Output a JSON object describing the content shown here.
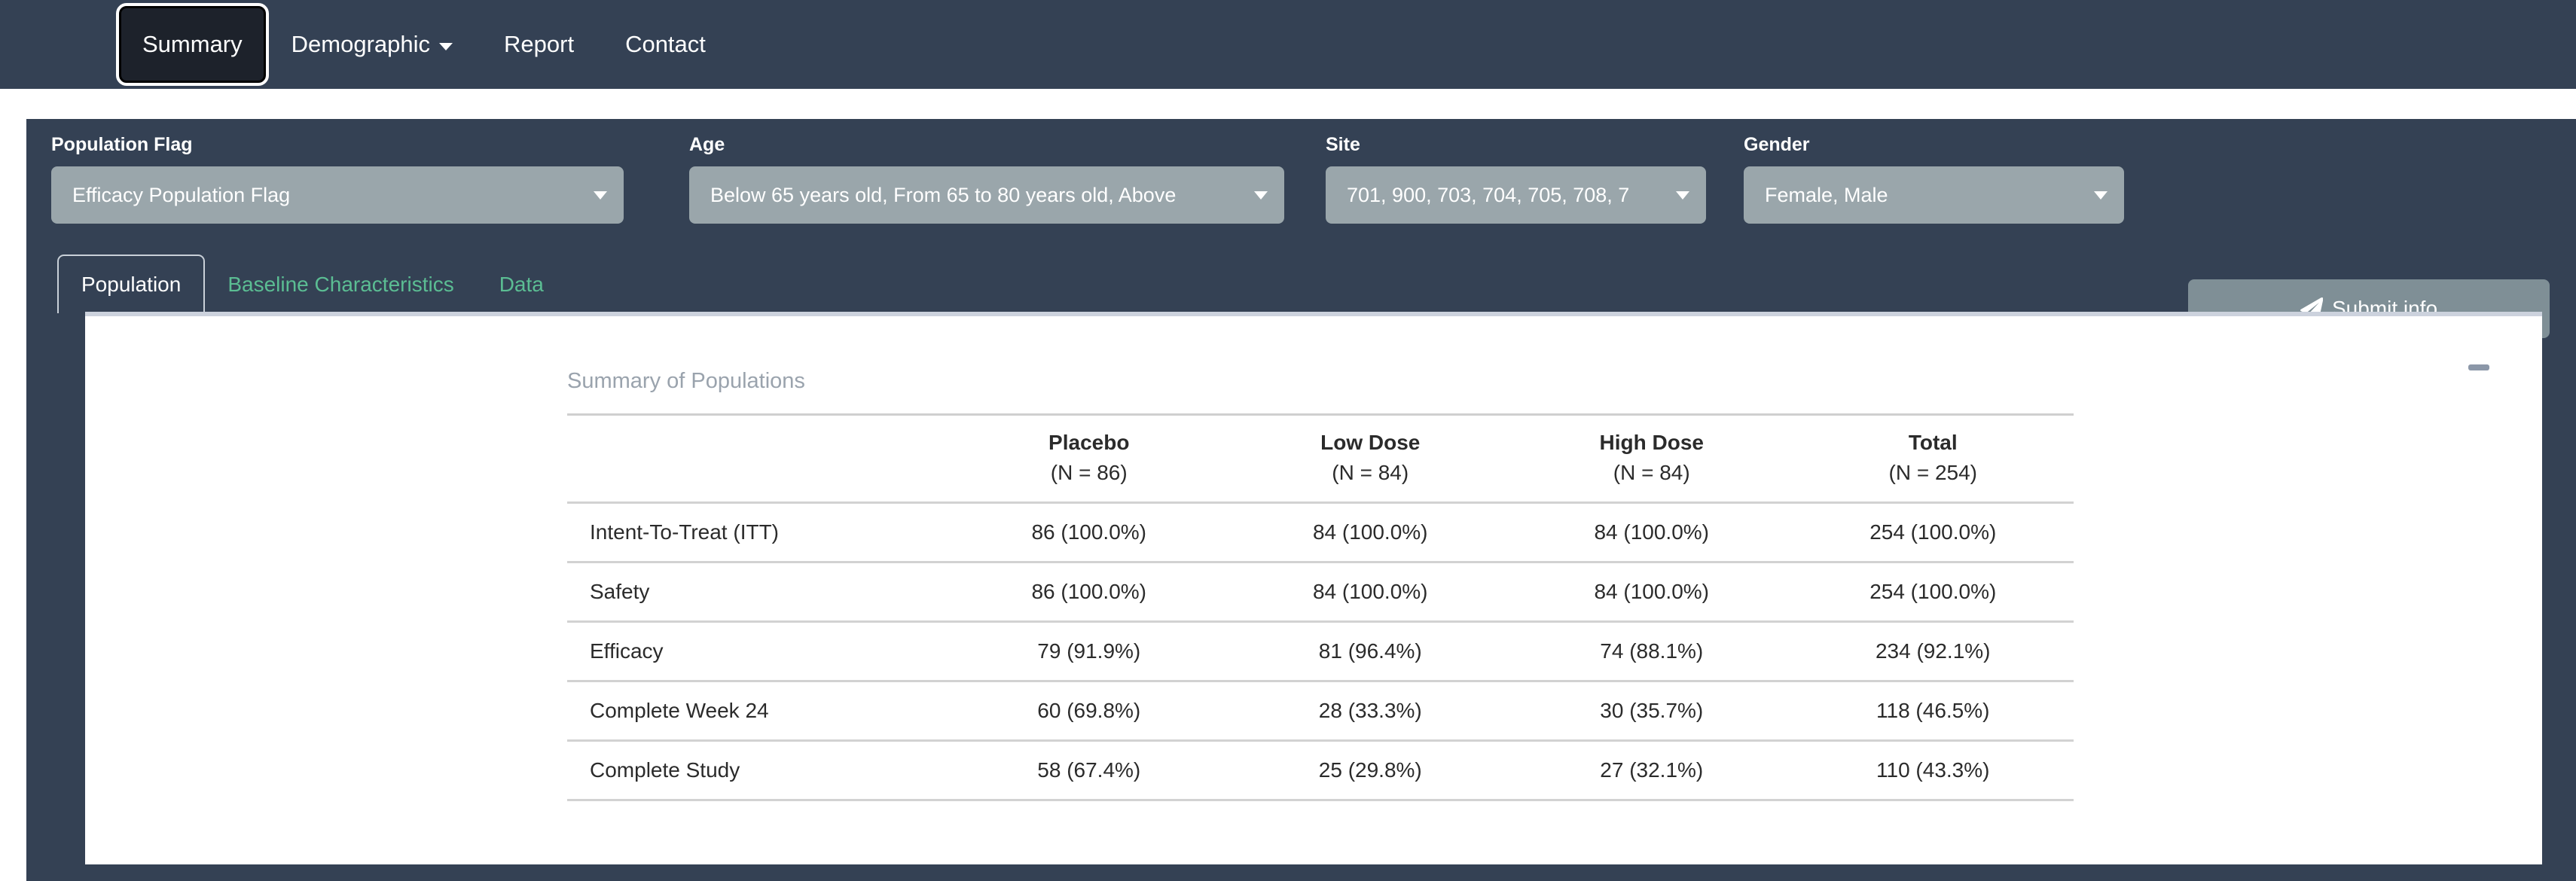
{
  "navbar": {
    "items": [
      {
        "label": "Summary",
        "active": true,
        "has_caret": false
      },
      {
        "label": "Demographic",
        "active": false,
        "has_caret": true
      },
      {
        "label": "Report",
        "active": false,
        "has_caret": false
      },
      {
        "label": "Contact",
        "active": false,
        "has_caret": false
      }
    ]
  },
  "filters": {
    "population_flag": {
      "label": "Population Flag",
      "value": "Efficacy Population Flag"
    },
    "age": {
      "label": "Age",
      "value": "Below 65 years old, From 65 to 80 years old, Above"
    },
    "site": {
      "label": "Site",
      "value": "701, 900, 703, 704, 705, 708, 7"
    },
    "gender": {
      "label": "Gender",
      "value": "Female, Male"
    },
    "submit": {
      "label": "Submit info",
      "icon": "paper-plane-icon"
    }
  },
  "tabs": [
    {
      "label": "Population",
      "active": true
    },
    {
      "label": "Baseline Characteristics",
      "active": false
    },
    {
      "label": "Data",
      "active": false
    }
  ],
  "card": {
    "minimize_icon": "minimize-icon",
    "title": "Summary of Populations",
    "table": {
      "columns": [
        {
          "name": "",
          "n": ""
        },
        {
          "name": "Placebo",
          "n": "(N = 86)"
        },
        {
          "name": "Low Dose",
          "n": "(N = 84)"
        },
        {
          "name": "High Dose",
          "n": "(N = 84)"
        },
        {
          "name": "Total",
          "n": "(N = 254)"
        }
      ],
      "rows": [
        {
          "label": "Intent-To-Treat (ITT)",
          "placebo": "86 (100.0%)",
          "low": "84 (100.0%)",
          "high": "84 (100.0%)",
          "total": "254 (100.0%)"
        },
        {
          "label": "Safety",
          "placebo": "86 (100.0%)",
          "low": "84 (100.0%)",
          "high": "84 (100.0%)",
          "total": "254 (100.0%)"
        },
        {
          "label": "Efficacy",
          "placebo": "79 (91.9%)",
          "low": "81 (96.4%)",
          "high": "74 (88.1%)",
          "total": "234 (92.1%)"
        },
        {
          "label": "Complete Week 24",
          "placebo": "60 (69.8%)",
          "low": "28 (33.3%)",
          "high": "30 (35.7%)",
          "total": "118 (46.5%)"
        },
        {
          "label": "Complete Study",
          "placebo": "58 (67.4%)",
          "low": "25 (29.8%)",
          "high": "27 (32.1%)",
          "total": "110 (43.3%)"
        }
      ]
    }
  },
  "colors": {
    "navbar_bg": "#344154",
    "panel_bg": "#344154",
    "select_bg": "#9aa6ab",
    "submit_bg": "#7f8f96",
    "tab_link": "#5bbd93",
    "card_bg": "#ffffff",
    "title_gray": "#9aa3ad",
    "active_tab_bg": "#1d222b"
  }
}
